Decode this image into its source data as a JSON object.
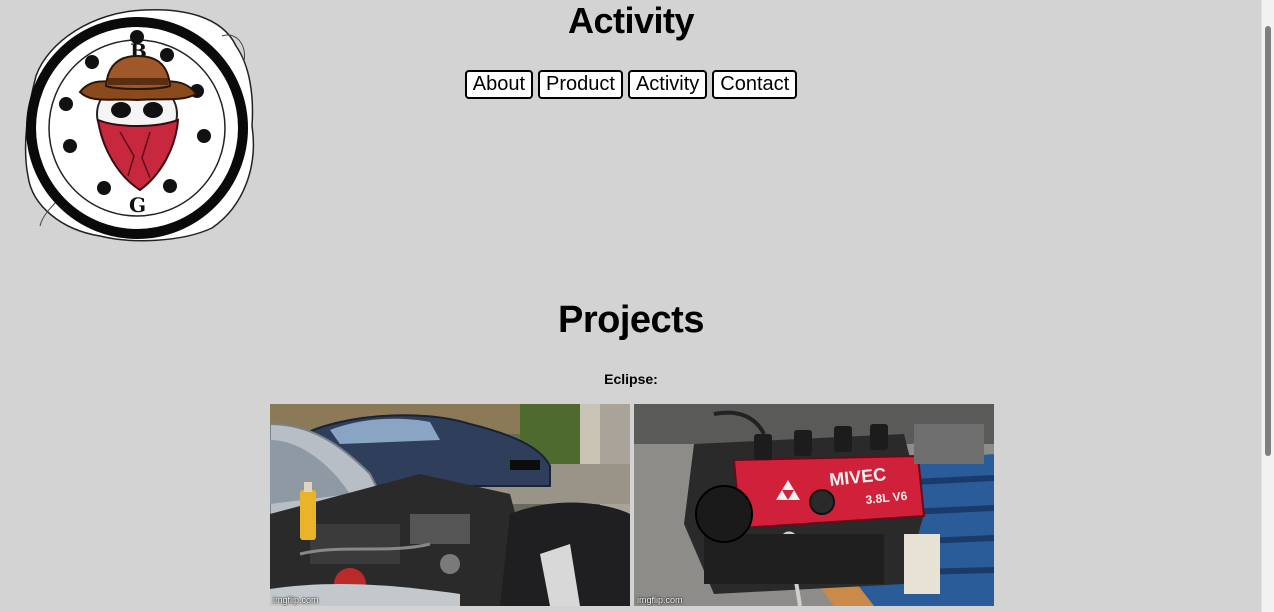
{
  "header": {
    "title": "Activity",
    "logo": {
      "icon": "bandit-skull-logo-icon",
      "letters": [
        "B",
        "G"
      ]
    }
  },
  "nav": {
    "items": [
      {
        "label": "About"
      },
      {
        "label": "Product"
      },
      {
        "label": "Activity"
      },
      {
        "label": "Contact"
      }
    ]
  },
  "main": {
    "section_title": "Projects",
    "project_label": "Eclipse:",
    "photos": [
      {
        "icon": "car-engine-bay-photo",
        "watermark": "imgflip.com"
      },
      {
        "icon": "red-engine-block-photo",
        "watermark": "imgflip.com"
      }
    ]
  },
  "colors": {
    "background": "#d3d3d3",
    "button_bg": "#ffffff",
    "bandana_red": "#c8283e",
    "hat_brown": "#8b4a1c",
    "valve_cover_red": "#d0203a"
  }
}
